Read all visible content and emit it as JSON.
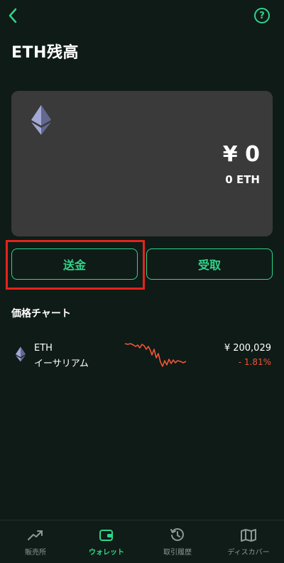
{
  "header": {
    "title": "ETH残高",
    "back_icon": "chevron-left-icon",
    "help_label": "?"
  },
  "balance_card": {
    "fiat_balance": "¥ 0",
    "crypto_balance": "0 ETH",
    "coin_icon": "ethereum-icon"
  },
  "actions": {
    "send_label": "送金",
    "receive_label": "受取"
  },
  "price_chart": {
    "section_title": "価格チャート",
    "coin_symbol": "ETH",
    "coin_name": "イーサリアム",
    "price": "¥ 200,029",
    "change": "- 1.81%",
    "trend_color": "#f05536"
  },
  "bottom_nav": {
    "items": [
      {
        "label": "販売所",
        "icon": "trend-up-icon"
      },
      {
        "label": "ウォレット",
        "icon": "wallet-icon"
      },
      {
        "label": "取引履歴",
        "icon": "history-icon"
      },
      {
        "label": "ディスカバー",
        "icon": "map-icon"
      }
    ],
    "active_index": 1
  },
  "colors": {
    "accent": "#2fd58a",
    "background": "#0f1b17",
    "card": "#3a3a3a",
    "negative": "#f05536",
    "highlight": "#e3241b"
  }
}
